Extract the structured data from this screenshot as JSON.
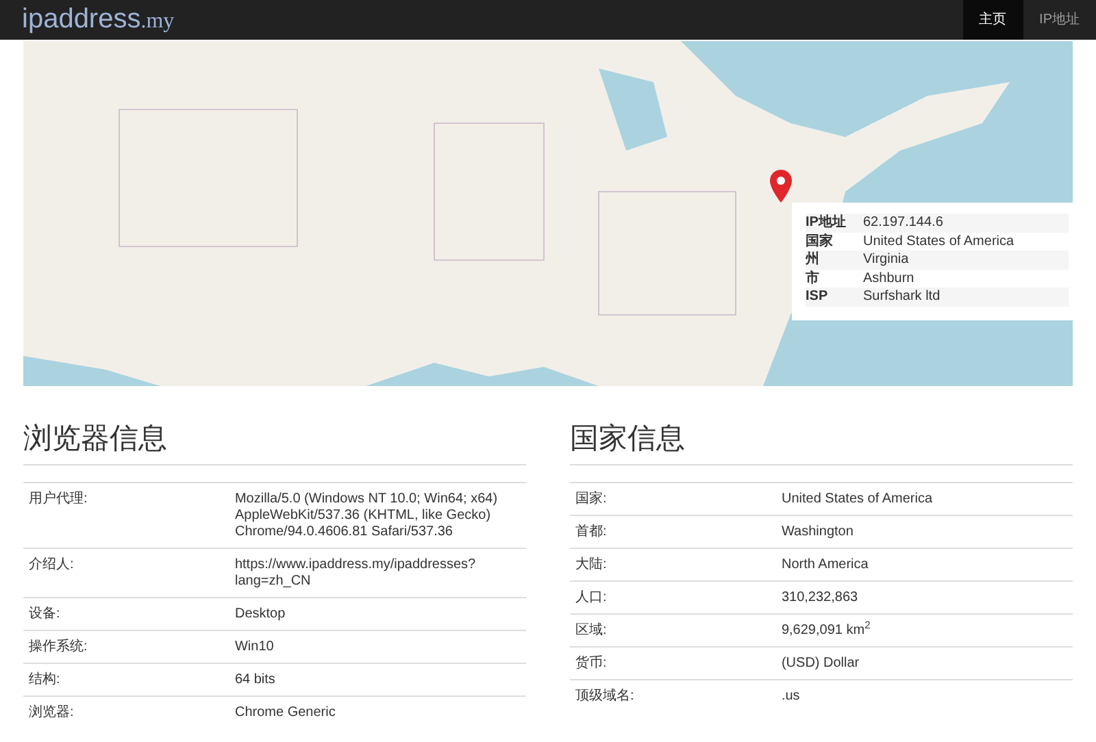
{
  "navbar": {
    "brand": "ipaddress",
    "brand_suffix": ".my",
    "links": [
      {
        "label": "主页",
        "selected": true
      },
      {
        "label": "IP地址",
        "selected": false
      }
    ]
  },
  "map": {
    "popup": [
      {
        "label": "IP地址",
        "value": "62.197.144.6"
      },
      {
        "label": "国家",
        "value": "United States of America"
      },
      {
        "label": "州",
        "value": "Virginia"
      },
      {
        "label": "市",
        "value": "Ashburn"
      },
      {
        "label": "ISP",
        "value": "Surfshark ltd"
      }
    ]
  },
  "browser_info": {
    "title": "浏览器信息",
    "rows": [
      {
        "label": "用户代理:",
        "value": "Mozilla/5.0 (Windows NT 10.0; Win64; x64) AppleWebKit/537.36 (KHTML, like Gecko) Chrome/94.0.4606.81 Safari/537.36"
      },
      {
        "label": "介绍人:",
        "value": "https://www.ipaddress.my/ipaddresses?lang=zh_CN"
      },
      {
        "label": "设备:",
        "value": "Desktop"
      },
      {
        "label": "操作系统:",
        "value": "Win10"
      },
      {
        "label": "结构:",
        "value": "64 bits"
      },
      {
        "label": "浏览器:",
        "value": "Chrome Generic"
      }
    ]
  },
  "country_info": {
    "title": "国家信息",
    "rows": [
      {
        "label": "国家:",
        "value": "United States of America"
      },
      {
        "label": "首都:",
        "value": "Washington"
      },
      {
        "label": "大陆:",
        "value": "North America"
      },
      {
        "label": "人口:",
        "value": "310,232,863"
      },
      {
        "label": "区域:",
        "value": "9,629,091 km$^{2}$"
      },
      {
        "label": "货币:",
        "value": "(USD) Dollar"
      },
      {
        "label": "顶级域名:",
        "value": ".us"
      }
    ]
  }
}
